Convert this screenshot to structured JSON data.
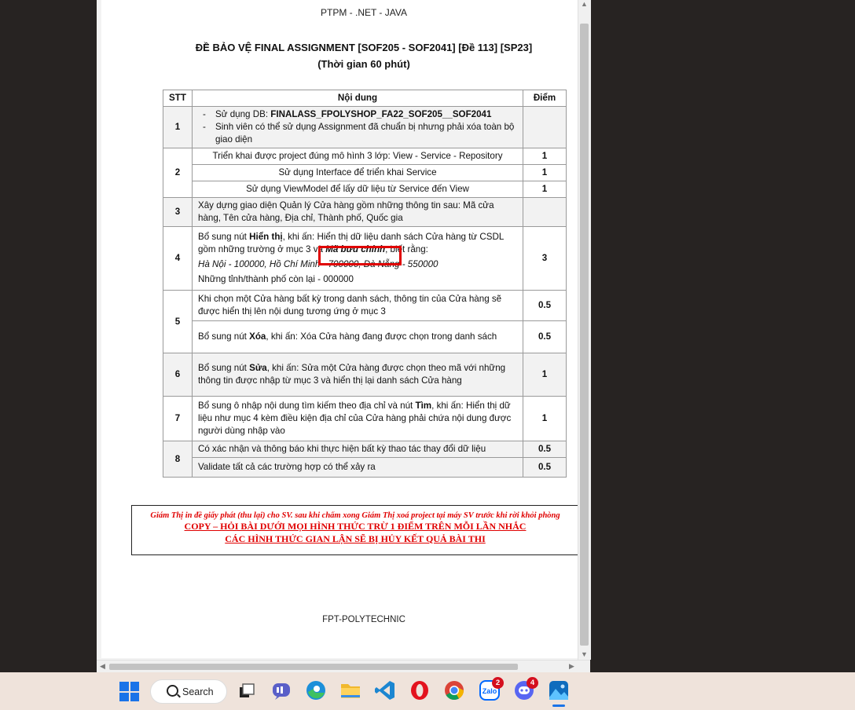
{
  "document": {
    "header": "PTPM - .NET - JAVA",
    "title_line1": "ĐỀ BẢO VỆ FINAL ASSIGNMENT [SOF205 - SOF2041] [Đề 113] [SP23]",
    "title_line2": "(Thời gian 60 phút)",
    "table": {
      "headers": [
        "STT",
        "Nội dung",
        "Điểm"
      ],
      "row1": {
        "stt": "1",
        "bullet1_prefix": "Sử dụng DB: ",
        "bullet1_bold": "FINALASS_FPOLYSHOP_FA22_SOF205__SOF2041",
        "bullet2": "Sinh viên có thể sử dụng Assignment đã chuẩn bị nhưng phải xóa toàn bộ giao diện",
        "score": ""
      },
      "row2": {
        "stt": "2",
        "items": [
          {
            "text": "Triển khai được project đúng mô hình 3 lớp: View - Service - Repository",
            "score": "1"
          },
          {
            "text": "Sử dụng Interface để triển khai Service",
            "score": "1"
          },
          {
            "text": "Sử dụng ViewModel để lấy dữ liệu từ Service đến View",
            "score": "1"
          }
        ]
      },
      "row3": {
        "stt": "3",
        "text": "Xây dựng giao diện Quản lý Cửa hàng gồm những thông tin sau: Mã cửa hàng, Tên cửa hàng, Địa chỉ, Thành phố, Quốc gia",
        "score": ""
      },
      "row4": {
        "stt": "4",
        "p1_a": "Bổ sung nút ",
        "p1_b": "Hiển thị",
        "p1_c": ", khi ấn: Hiển thị dữ liệu danh sách Cửa hàng từ CSDL gồm những trường ở mục 3 và ",
        "p1_d": "Mã bưu chính",
        "p1_e": ", biết rằng:",
        "p2": "Hà Nội - 100000, Hồ Chí Minh - 700000, Đà Nẵng - 550000",
        "p3": "Những tỉnh/thành phố còn lại - 000000",
        "score": "3"
      },
      "row5": {
        "stt": "5",
        "a_text": "Khi chọn một Cửa hàng bất kỳ trong danh sách, thông tin của Cửa hàng sẽ được hiển thị lên nội dung tương ứng ở mục 3",
        "a_score": "0.5",
        "b_a": "Bổ sung nút ",
        "b_b": "Xóa",
        "b_c": ", khi ấn: Xóa Cửa hàng đang được chọn trong danh sách",
        "b_score": "0.5"
      },
      "row6": {
        "stt": "6",
        "t_a": "Bổ sung nút ",
        "t_b": "Sửa",
        "t_c": ", khi ấn: Sửa một Cửa hàng được chọn theo mã với những thông tin được nhập từ mục 3 và hiển thị lại danh sách Cửa hàng",
        "score": "1"
      },
      "row7": {
        "stt": "7",
        "t_a": "Bổ sung ô nhập nội dung tìm kiếm theo địa chỉ và nút ",
        "t_b": "Tìm",
        "t_c": ", khi ấn: Hiển thị dữ liệu như mục 4 kèm điều kiện địa chỉ của Cửa hàng phải chứa nội dung được người dùng nhập vào",
        "score": "1"
      },
      "row8": {
        "stt": "8",
        "a_text": "Có xác nhận và thông báo khi thực hiện bất kỳ thao tác thay đổi dữ liệu",
        "a_score": "0.5",
        "b_text": "Validate tất cả các trường hợp có thể xảy ra",
        "b_score": "0.5"
      }
    },
    "notice": {
      "line1": "Giám Thị in đề giấy phát (thu lại) cho SV. sau khi chấm xong Giám Thị xoá project tại máy SV trước khi rời khỏi phòng",
      "line2": "COPY – HỎI BÀI DƯỚI MỌI HÌNH THỨC TRỪ 1 ĐIỂM TRÊN MỖI LẦN NHẮC",
      "line3": "CÁC HÌNH THỨC GIAN LẬN SẼ BỊ HỦY KẾT QUẢ BÀI THI"
    },
    "footer": "FPT-POLYTECHNIC"
  },
  "taskbar": {
    "search_label": "Search",
    "zalo_badge": "2",
    "discord_badge": "4",
    "icons": [
      "windows-start-icon",
      "search-icon",
      "task-view-icon",
      "chat-icon",
      "edge-icon",
      "file-explorer-icon",
      "vscode-icon",
      "opera-icon",
      "chrome-icon",
      "zalo-icon",
      "discord-icon",
      "photos-icon"
    ]
  },
  "colors": {
    "accent_red": "#e00000",
    "taskbar_bg": "#efe3db",
    "desktop_bg": "#272322"
  }
}
